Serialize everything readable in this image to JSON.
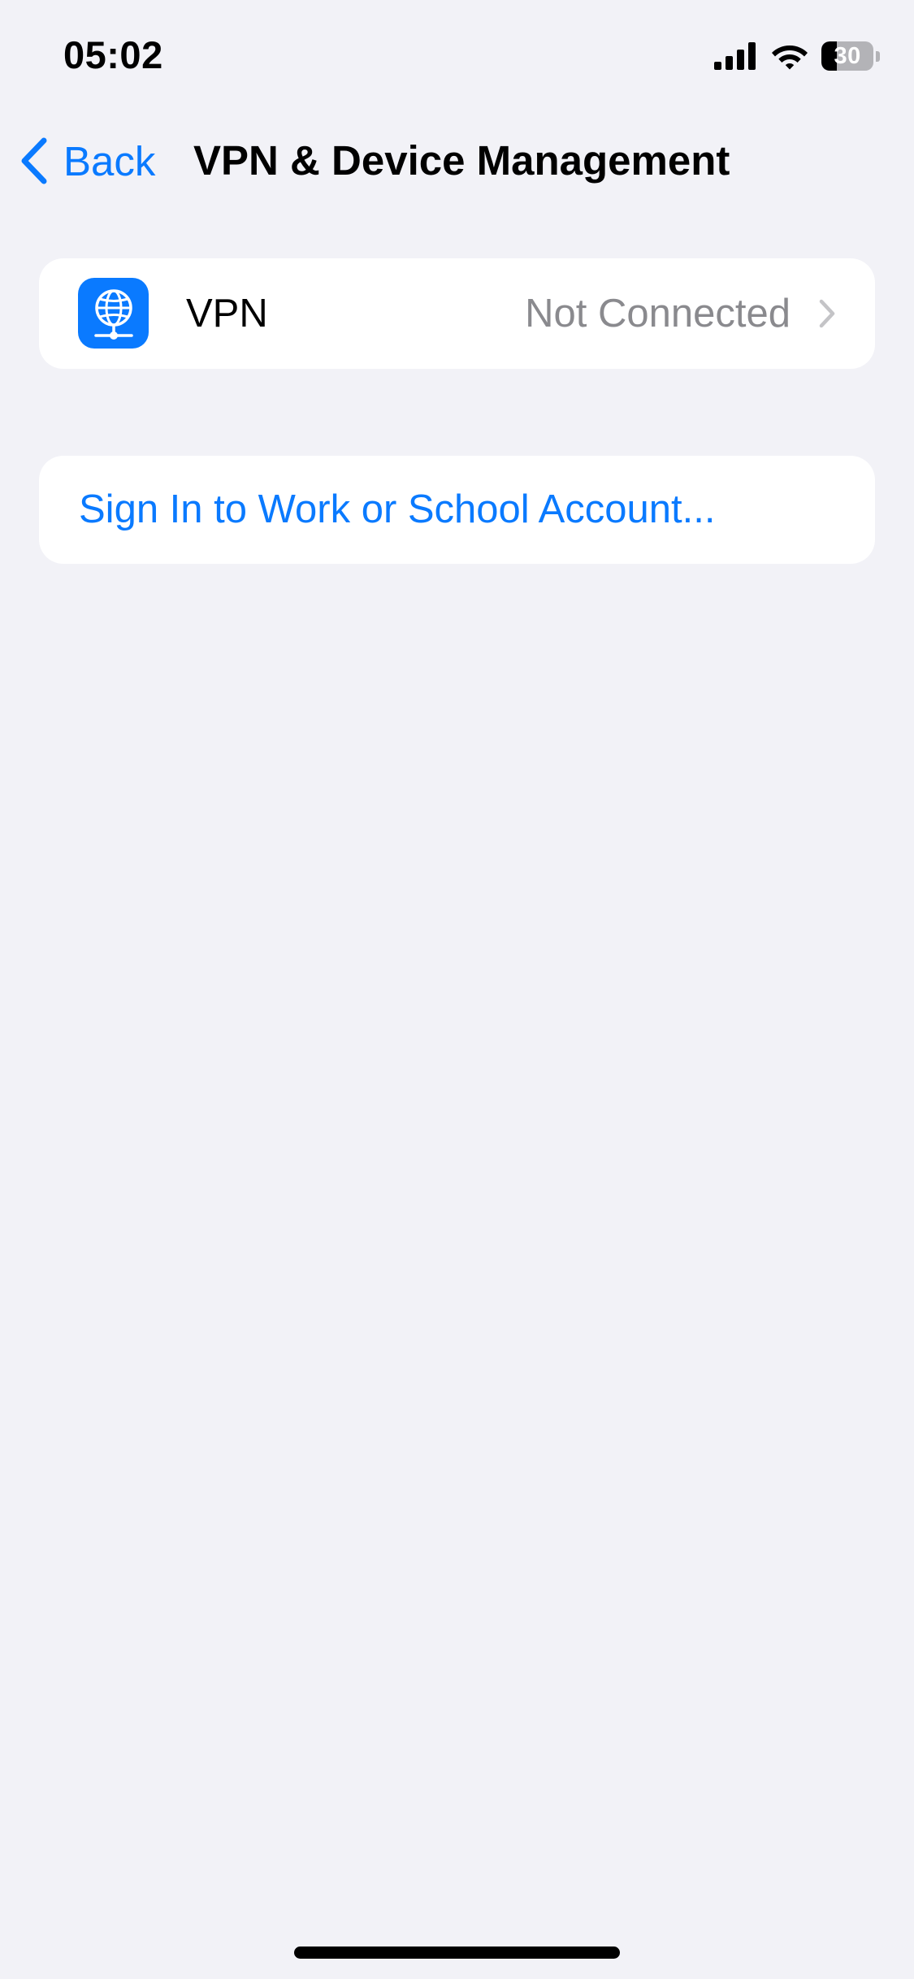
{
  "status_bar": {
    "time": "05:02",
    "battery_level": "30",
    "battery_fraction": 0.3,
    "signal_icon": "cellular-signal-icon",
    "wifi_icon": "wifi-icon"
  },
  "nav": {
    "back_label": "Back",
    "title": "VPN & Device Management"
  },
  "vpn_row": {
    "label": "VPN",
    "status": "Not Connected",
    "icon": "globe-network-icon"
  },
  "account_row": {
    "label": "Sign In to Work or School Account..."
  },
  "colors": {
    "accent": "#0a7aff",
    "background": "#f2f2f7",
    "cell": "#ffffff",
    "secondary_text": "#8a8a8e"
  }
}
